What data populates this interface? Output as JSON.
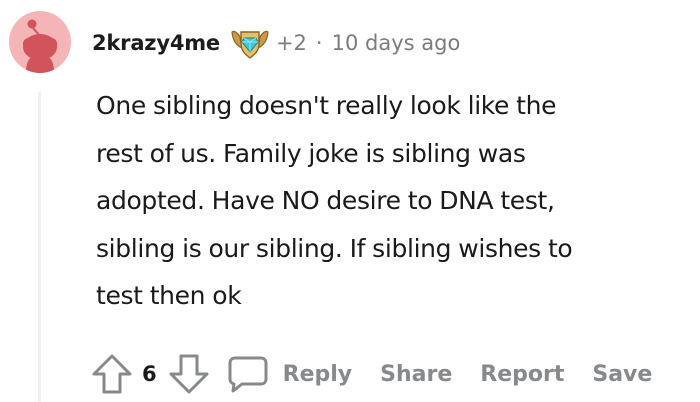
{
  "comment": {
    "username": "2krazy4me",
    "award_count": "+2",
    "separator": "·",
    "timestamp": "10 days ago",
    "body_lines": [
      "One sibling doesn't really look like the",
      "rest of us. Family joke is sibling was",
      "adopted. Have NO desire to DNA test,",
      "sibling is our sibling. If sibling wishes to",
      "test then ok"
    ]
  },
  "actions": {
    "vote_count": "6",
    "reply_label": "Reply",
    "share_label": "Share",
    "report_label": "Report",
    "save_label": "Save"
  },
  "icons": {
    "avatar": "snoo-avatar-icon",
    "award": "award-badge-icon",
    "upvote": "upvote-arrow-icon",
    "downvote": "downvote-arrow-icon",
    "reply": "speech-bubble-icon"
  },
  "colors": {
    "avatar_bg": "#f5b5b6",
    "meta_text": "#7c7c7c",
    "action_text": "#878a8c",
    "thread_line": "#edeff1"
  }
}
